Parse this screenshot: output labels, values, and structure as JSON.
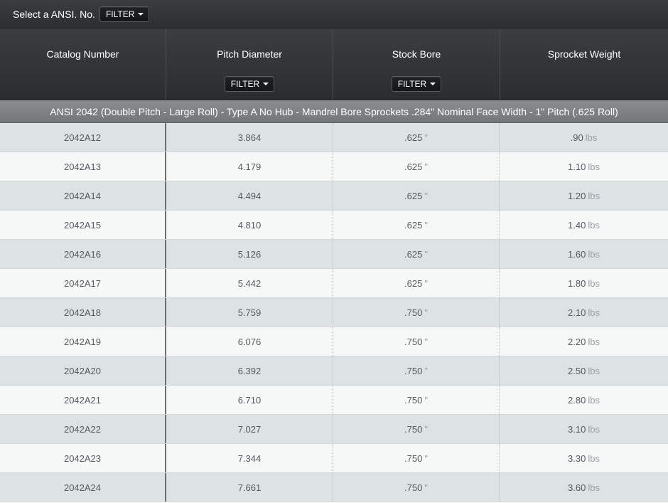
{
  "topbar": {
    "label": "Select a ANSI. No.",
    "filter_label": "FILTER"
  },
  "columns": [
    {
      "title": "Catalog Number",
      "filter": ""
    },
    {
      "title": "Pitch Diameter",
      "filter": "FILTER"
    },
    {
      "title": "Stock Bore",
      "filter": "FILTER"
    },
    {
      "title": "Sprocket Weight",
      "filter": ""
    }
  ],
  "group_title": "ANSI 2042 (Double Pitch - Large Roll) - Type A No Hub - Mandrel Bore Sprockets .284\" Nominal Face Width - 1\" Pitch (.625 Roll)",
  "bore_unit": "\"",
  "weight_unit": "lbs",
  "rows": [
    {
      "catalog": "2042A12",
      "pitch": "3.864",
      "bore": ".625",
      "weight": ".90"
    },
    {
      "catalog": "2042A13",
      "pitch": "4.179",
      "bore": ".625",
      "weight": "1.10"
    },
    {
      "catalog": "2042A14",
      "pitch": "4.494",
      "bore": ".625",
      "weight": "1.20"
    },
    {
      "catalog": "2042A15",
      "pitch": "4.810",
      "bore": ".625",
      "weight": "1.40"
    },
    {
      "catalog": "2042A16",
      "pitch": "5.126",
      "bore": ".625",
      "weight": "1.60"
    },
    {
      "catalog": "2042A17",
      "pitch": "5.442",
      "bore": ".625",
      "weight": "1.80"
    },
    {
      "catalog": "2042A18",
      "pitch": "5.759",
      "bore": ".750",
      "weight": "2.10"
    },
    {
      "catalog": "2042A19",
      "pitch": "6.076",
      "bore": ".750",
      "weight": "2.20"
    },
    {
      "catalog": "2042A20",
      "pitch": "6.392",
      "bore": ".750",
      "weight": "2.50"
    },
    {
      "catalog": "2042A21",
      "pitch": "6.710",
      "bore": ".750",
      "weight": "2.80"
    },
    {
      "catalog": "2042A22",
      "pitch": "7.027",
      "bore": ".750",
      "weight": "3.10"
    },
    {
      "catalog": "2042A23",
      "pitch": "7.344",
      "bore": ".750",
      "weight": "3.30"
    },
    {
      "catalog": "2042A24",
      "pitch": "7.661",
      "bore": ".750",
      "weight": "3.60"
    }
  ]
}
